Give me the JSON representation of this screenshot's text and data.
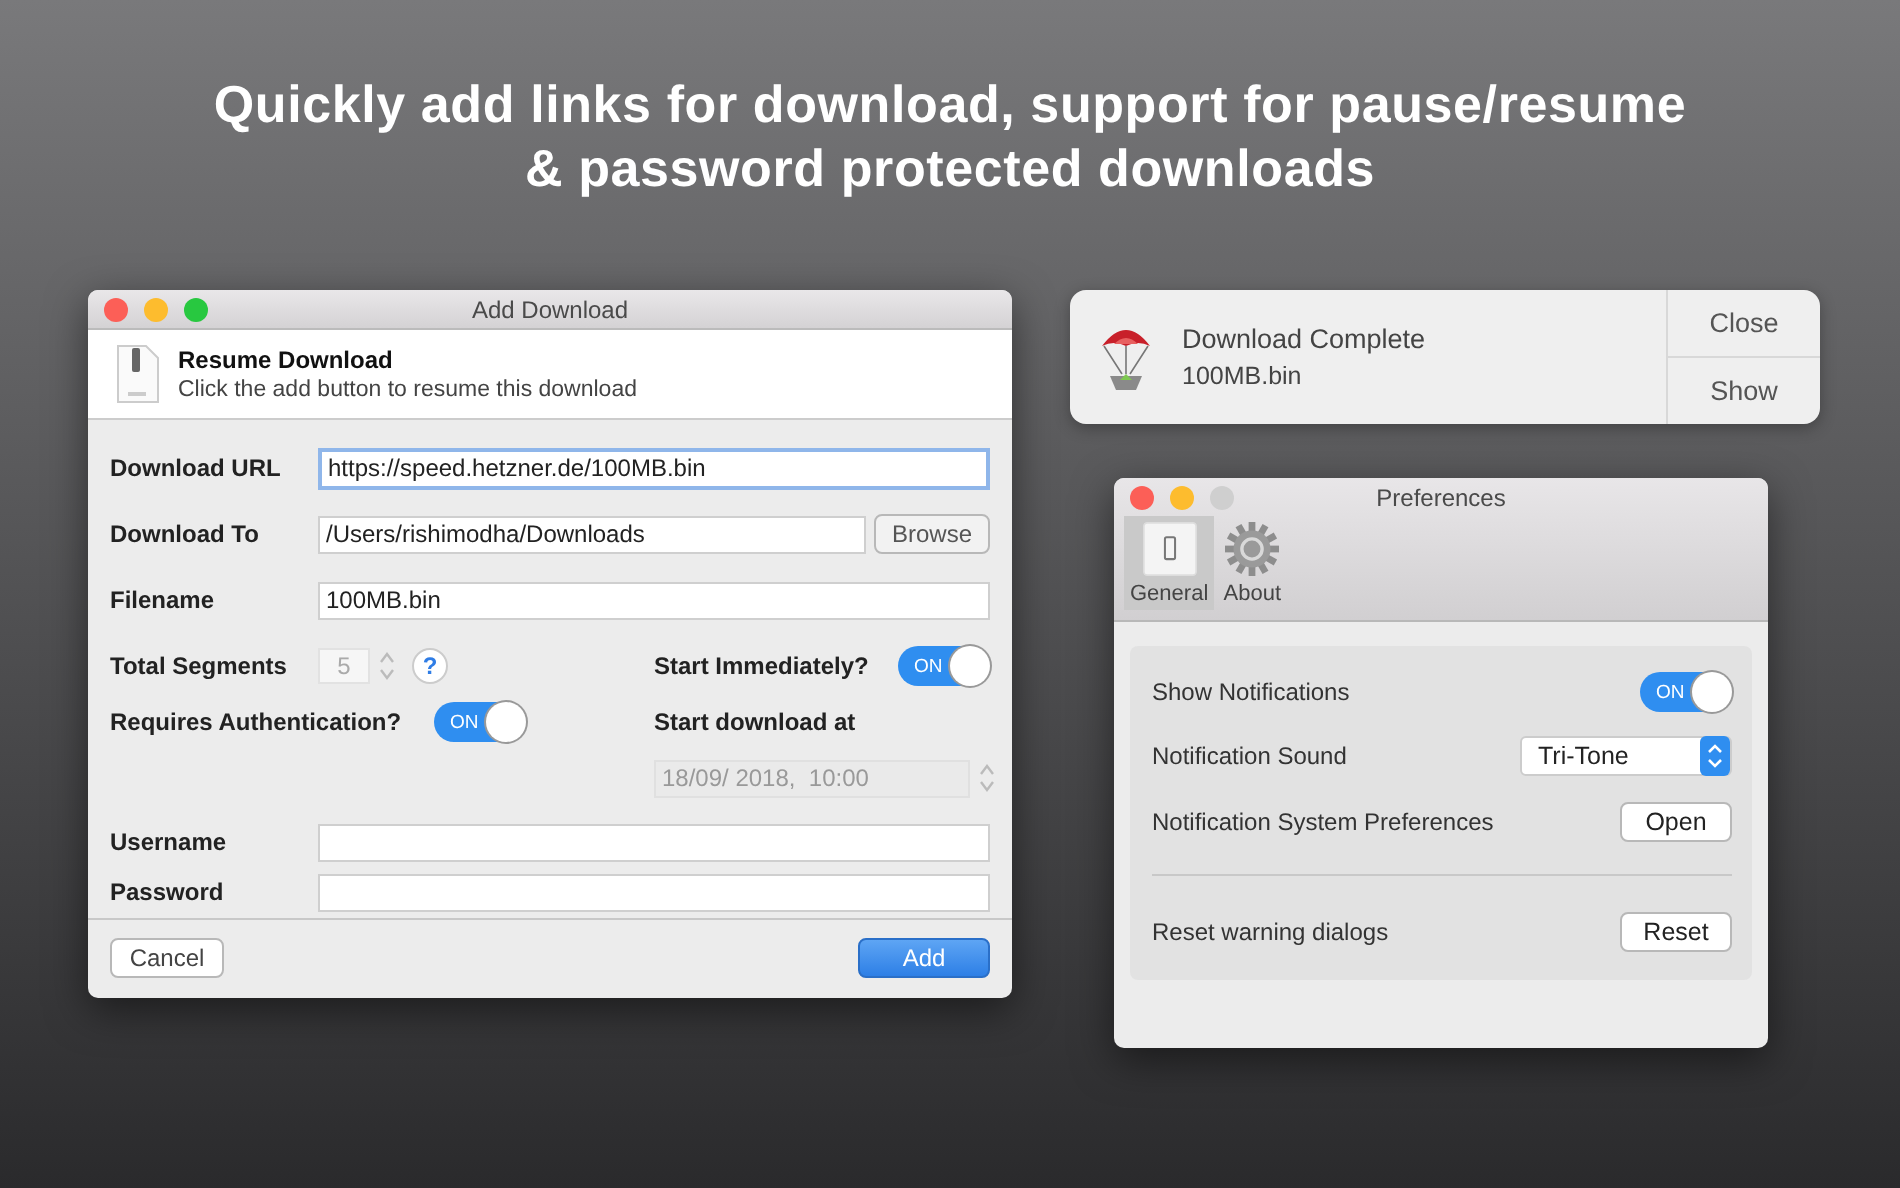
{
  "headline": {
    "lines": [
      "Quickly add links for download, support for pause/resume",
      "& password protected downloads"
    ]
  },
  "add_download": {
    "title": "Add Download",
    "zoom_enabled": true,
    "header": {
      "title": "Resume Download",
      "subtitle": "Click the add button to resume this download"
    },
    "download_url": {
      "label": "Download URL",
      "value": "https://speed.hetzner.de/100MB.bin",
      "focused": true
    },
    "download_to": {
      "label": "Download To",
      "value": "/Users/rishimodha/Downloads",
      "button": "Browse"
    },
    "filename": {
      "label": "Filename",
      "value": "100MB.bin"
    },
    "total_segments": {
      "label": "Total Segments",
      "value": "5",
      "disabled": true,
      "help": "?"
    },
    "start_immediately": {
      "label": "Start Immediately?",
      "toggle_label": "ON",
      "on": true
    },
    "requires_authentication": {
      "label": "Requires Authentication?",
      "toggle_label": "ON",
      "on": true
    },
    "start_download_at": {
      "label": "Start download at",
      "value": "18/09/ 2018,  10:00",
      "disabled": true
    },
    "username": {
      "label": "Username"
    },
    "password": {
      "label": "Password"
    },
    "buttons": [
      {
        "label": "Cancel",
        "default": false
      },
      {
        "label": "Add",
        "default": true
      }
    ]
  },
  "notification": {
    "title": "Download Complete",
    "subtitle": "100MB.bin",
    "actions": [
      "Close",
      "Show"
    ]
  },
  "preferences": {
    "title": "Preferences",
    "zoom_enabled": false,
    "tabs": [
      {
        "label": "General",
        "kind": "switch",
        "selected": true
      },
      {
        "label": "About",
        "kind": "gear",
        "selected": false
      }
    ],
    "rows": [
      {
        "kind": "toggle",
        "label": "Show Notifications",
        "toggle_label": "ON",
        "on": true
      },
      {
        "kind": "select",
        "label": "Notification Sound",
        "value": "Tri-Tone"
      },
      {
        "kind": "button",
        "label": "Notification System Preferences",
        "button": "Open"
      },
      {
        "kind": "separator"
      },
      {
        "kind": "button",
        "label": "Reset warning dialogs",
        "button": "Reset"
      }
    ]
  }
}
